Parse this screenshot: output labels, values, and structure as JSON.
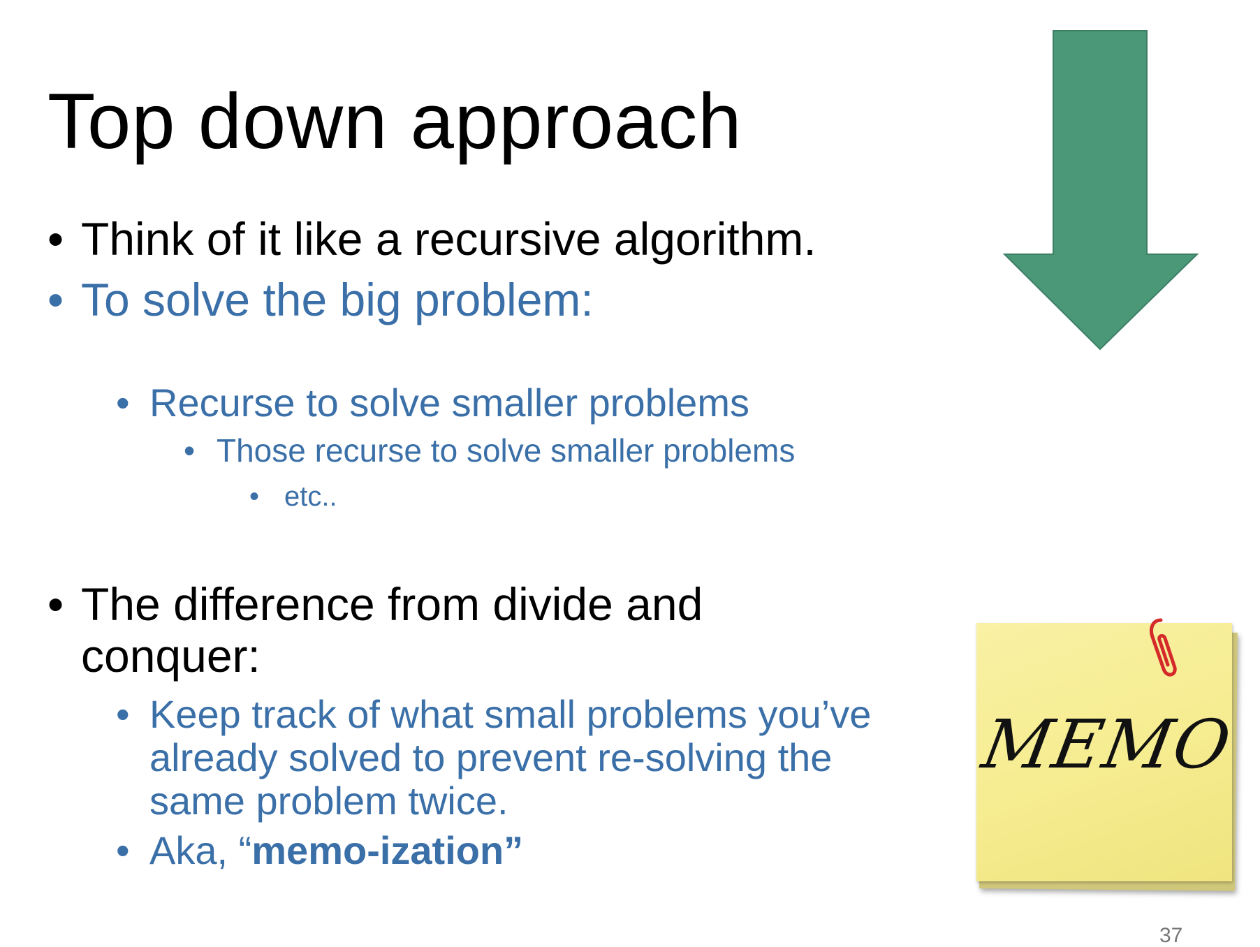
{
  "slide": {
    "title": "Top down approach",
    "bullets": [
      {
        "text": "Think of it like a recursive algorithm."
      },
      {
        "text": "To solve the big problem:"
      },
      {
        "text": "Recurse to solve smaller problems"
      },
      {
        "text": "Those recurse to solve smaller problems"
      },
      {
        "text": "etc.."
      },
      {
        "line1": "The difference from divide and",
        "line2": "conquer:"
      },
      {
        "line1": "Keep track of what small problems you’ve",
        "line2": "already solved to prevent re-solving the",
        "line3": "same problem twice."
      },
      {
        "prefix": "Aka, “",
        "bold": "memo-ization”"
      }
    ],
    "bullet_symbol": "•",
    "memo_text": "MEMO",
    "page_number": "37"
  },
  "colors": {
    "text": "#000000",
    "accent_blue": "#3a6fa8",
    "arrow_green": "#4a9878",
    "memo_yellow": "#f6ec90",
    "paperclip_red": "#d42a2a"
  },
  "icons": {
    "arrow": "down-arrow-icon",
    "memo": "sticky-note-icon",
    "clip": "paperclip-icon"
  }
}
